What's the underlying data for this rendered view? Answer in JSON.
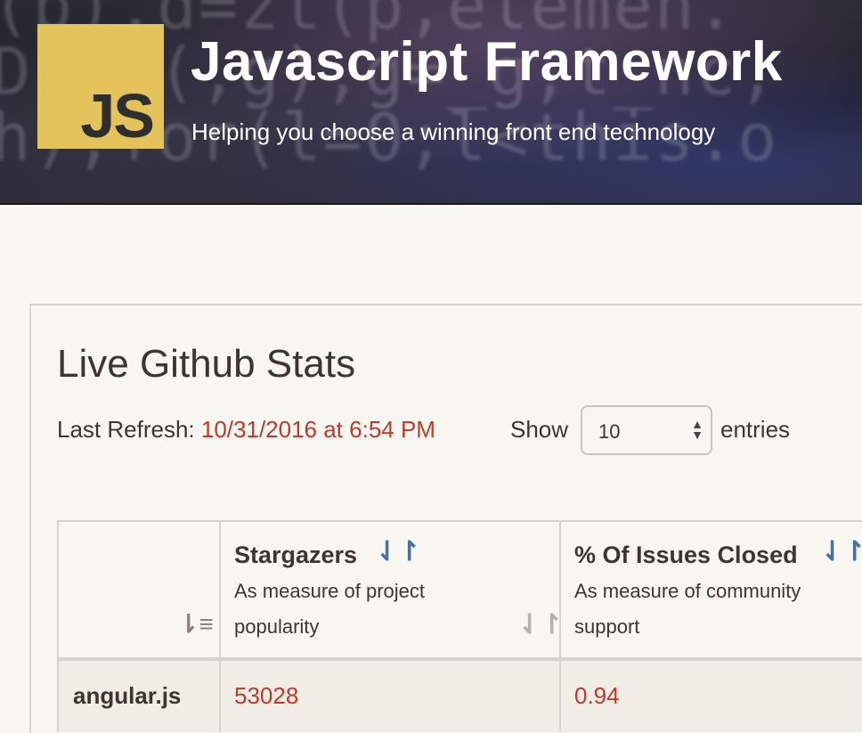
{
  "header": {
    "logo_text": "JS",
    "title": "Javascript Framework",
    "tagline": "Helping you choose a winning front end technology",
    "background_code": [
      "(p),d=zt(p,elemen.",
      "D ,b(,g),g=_g,t_nc,",
      "h);for(l=0;l<this.o"
    ]
  },
  "stats": {
    "title": "Live Github Stats",
    "refresh_label": "Last Refresh:",
    "refresh_value": "10/31/2016 at 6:54 PM",
    "show_label": "Show",
    "entries_select_value": "10",
    "entries_label": "entries"
  },
  "table": {
    "columns": [
      {
        "title": "",
        "subtitle": ""
      },
      {
        "title": "Stargazers",
        "subtitle_line1": "As measure of project",
        "subtitle_line2": "popularity"
      },
      {
        "title": "% Of Issues Closed",
        "subtitle_line1": "As measure of community",
        "subtitle_line2": "support"
      }
    ],
    "rows": [
      {
        "name": "angular.js",
        "stargazers": "53028",
        "issues_closed": "0.94"
      }
    ]
  },
  "colors": {
    "accent_red": "#c0392b",
    "sort_blue": "#4a6fa5",
    "logo_yellow": "#e4c45a"
  },
  "icons": {
    "sort_icon": "up-down-arrows-icon",
    "sort_active_icon": "sort-amount-down-icon",
    "select_caret": "select-caret-icon"
  }
}
